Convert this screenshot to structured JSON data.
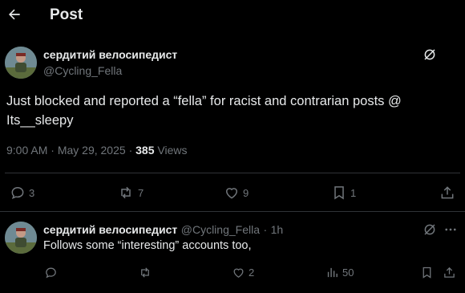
{
  "header": {
    "title": "Post",
    "back_icon": "arrow-left-icon"
  },
  "post": {
    "display_name": "сердитий велосипедист",
    "handle": "@Cycling_Fella",
    "text_line1": "Just blocked and reported a “fella” for racist and contrarian posts @",
    "text_line2": "Its__sleepy",
    "time": "9:00 AM",
    "sep1": "·",
    "date": "May 29, 2025",
    "sep2": "·",
    "views": "385",
    "views_label": "Views",
    "actions": {
      "replies": "3",
      "reposts": "7",
      "likes": "9",
      "bookmarks": "1"
    }
  },
  "reply": {
    "display_name": "сердитий велосипедист",
    "handle": "@Cycling_Fella",
    "sep": "·",
    "age": "1h",
    "text": "Follows some “interesting” accounts too,",
    "actions": {
      "likes": "2",
      "views": "50"
    }
  },
  "colors": {
    "background": "#000000",
    "text": "#e7e9ea",
    "muted": "#71767b",
    "divider": "#2f3336"
  }
}
